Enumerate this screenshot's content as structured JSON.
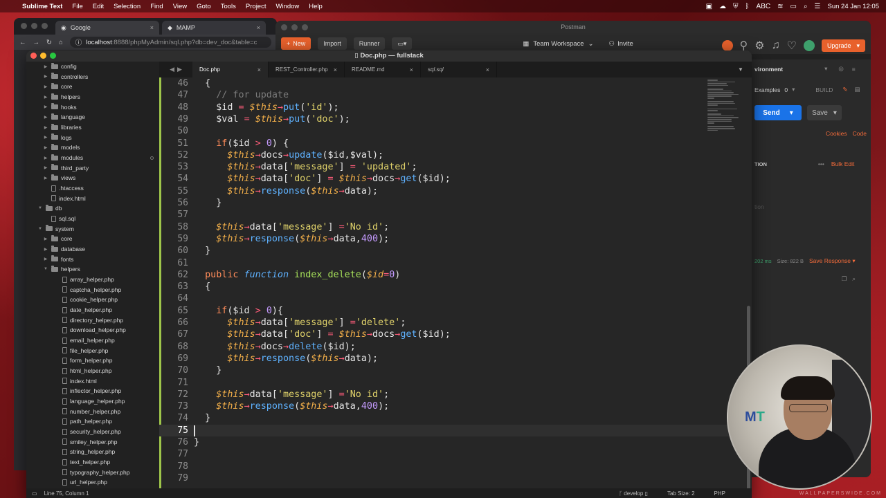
{
  "menubar": {
    "app": "Sublime Text",
    "items": [
      "File",
      "Edit",
      "Selection",
      "Find",
      "View",
      "Goto",
      "Tools",
      "Project",
      "Window",
      "Help"
    ],
    "keyboard": "ABC",
    "clock": "Sun 24 Jan  12:05"
  },
  "browser": {
    "tabs": [
      "Google",
      "MAMP"
    ],
    "url_host": "localhost",
    "url_rest": ":8888/phpMyAdmin/sql.php?db=dev_doc&table=c"
  },
  "postman": {
    "title": "Postman",
    "new": "New",
    "import": "Import",
    "runner": "Runner",
    "workspace": "Team Workspace",
    "invite": "Invite",
    "upgrade": "Upgrade",
    "environment": "vironment",
    "examples": "Examples",
    "examples_count": "0",
    "build": "BUILD",
    "send": "Send",
    "save": "Save",
    "cookies": "Cookies",
    "code": "Code",
    "description_col": "TION",
    "bulk_edit": "Bulk Edit",
    "desc_placeholder": "tion",
    "time": "202 ms",
    "size": "Size: 822 B",
    "save_response": "Save Response"
  },
  "sublime": {
    "title": "Doc.php — fullstack",
    "tabs": [
      "Doc.php",
      "REST_Controller.php",
      "README.md",
      "sql.sql"
    ],
    "sidebar": [
      {
        "label": "config",
        "type": "folder",
        "depth": 1
      },
      {
        "label": "controllers",
        "type": "folder",
        "depth": 1
      },
      {
        "label": "core",
        "type": "folder",
        "depth": 1
      },
      {
        "label": "helpers",
        "type": "folder",
        "depth": 1
      },
      {
        "label": "hooks",
        "type": "folder",
        "depth": 1
      },
      {
        "label": "language",
        "type": "folder",
        "depth": 1
      },
      {
        "label": "libraries",
        "type": "folder",
        "depth": 1
      },
      {
        "label": "logs",
        "type": "folder",
        "depth": 1
      },
      {
        "label": "models",
        "type": "folder",
        "depth": 1
      },
      {
        "label": "modules",
        "type": "folder",
        "depth": 1
      },
      {
        "label": "third_party",
        "type": "folder",
        "depth": 1
      },
      {
        "label": "views",
        "type": "folder",
        "depth": 1
      },
      {
        "label": ".htaccess",
        "type": "file",
        "depth": 1
      },
      {
        "label": "index.html",
        "type": "file",
        "depth": 1
      },
      {
        "label": "db",
        "type": "folder-open",
        "depth": 0
      },
      {
        "label": "sql.sql",
        "type": "file",
        "depth": 1
      },
      {
        "label": "system",
        "type": "folder-open",
        "depth": 0
      },
      {
        "label": "core",
        "type": "folder",
        "depth": 1
      },
      {
        "label": "database",
        "type": "folder",
        "depth": 1
      },
      {
        "label": "fonts",
        "type": "folder",
        "depth": 1
      },
      {
        "label": "helpers",
        "type": "folder-open",
        "depth": 1
      },
      {
        "label": "array_helper.php",
        "type": "file",
        "depth": 2
      },
      {
        "label": "captcha_helper.php",
        "type": "file",
        "depth": 2
      },
      {
        "label": "cookie_helper.php",
        "type": "file",
        "depth": 2
      },
      {
        "label": "date_helper.php",
        "type": "file",
        "depth": 2
      },
      {
        "label": "directory_helper.php",
        "type": "file",
        "depth": 2
      },
      {
        "label": "download_helper.php",
        "type": "file",
        "depth": 2
      },
      {
        "label": "email_helper.php",
        "type": "file",
        "depth": 2
      },
      {
        "label": "file_helper.php",
        "type": "file",
        "depth": 2
      },
      {
        "label": "form_helper.php",
        "type": "file",
        "depth": 2
      },
      {
        "label": "html_helper.php",
        "type": "file",
        "depth": 2
      },
      {
        "label": "index.html",
        "type": "file",
        "depth": 2
      },
      {
        "label": "inflector_helper.php",
        "type": "file",
        "depth": 2
      },
      {
        "label": "language_helper.php",
        "type": "file",
        "depth": 2
      },
      {
        "label": "number_helper.php",
        "type": "file",
        "depth": 2
      },
      {
        "label": "path_helper.php",
        "type": "file",
        "depth": 2
      },
      {
        "label": "security_helper.php",
        "type": "file",
        "depth": 2
      },
      {
        "label": "smiley_helper.php",
        "type": "file",
        "depth": 2
      },
      {
        "label": "string_helper.php",
        "type": "file",
        "depth": 2
      },
      {
        "label": "text_helper.php",
        "type": "file",
        "depth": 2
      },
      {
        "label": "typography_helper.php",
        "type": "file",
        "depth": 2
      },
      {
        "label": "url_helper.php",
        "type": "file",
        "depth": 2
      }
    ],
    "current_line": 75,
    "code": [
      {
        "n": 46,
        "t": [
          [
            "",
            "  {"
          ]
        ]
      },
      {
        "n": 47,
        "t": [
          [
            "cm",
            "    // for update"
          ]
        ]
      },
      {
        "n": 48,
        "t": [
          [
            "",
            "    $id "
          ],
          [
            "op",
            "="
          ],
          [
            "",
            " "
          ],
          [
            "var",
            "$this"
          ],
          [
            "op",
            "→"
          ],
          [
            "fn",
            "put"
          ],
          [
            "",
            "("
          ],
          [
            "str",
            "'id'"
          ],
          [
            "",
            ");"
          ]
        ]
      },
      {
        "n": 49,
        "t": [
          [
            "",
            "    $val "
          ],
          [
            "op",
            "="
          ],
          [
            "",
            " "
          ],
          [
            "var",
            "$this"
          ],
          [
            "op",
            "→"
          ],
          [
            "fn",
            "put"
          ],
          [
            "",
            "("
          ],
          [
            "str",
            "'doc'"
          ],
          [
            "",
            ");"
          ]
        ]
      },
      {
        "n": 50,
        "t": [
          [
            "",
            ""
          ]
        ]
      },
      {
        "n": 51,
        "t": [
          [
            "",
            "    "
          ],
          [
            "kw",
            "if"
          ],
          [
            "",
            "($id "
          ],
          [
            "op",
            ">"
          ],
          [
            "",
            " "
          ],
          [
            "num",
            "0"
          ],
          [
            "",
            ") {"
          ]
        ]
      },
      {
        "n": 52,
        "t": [
          [
            "",
            "      "
          ],
          [
            "var",
            "$this"
          ],
          [
            "op",
            "→"
          ],
          [
            "",
            "docs"
          ],
          [
            "op",
            "→"
          ],
          [
            "fn",
            "update"
          ],
          [
            "",
            "($id,$val);"
          ]
        ]
      },
      {
        "n": 53,
        "t": [
          [
            "",
            "      "
          ],
          [
            "var",
            "$this"
          ],
          [
            "op",
            "→"
          ],
          [
            "",
            "data["
          ],
          [
            "str",
            "'message'"
          ],
          [
            "",
            "] "
          ],
          [
            "op",
            "="
          ],
          [
            "",
            " "
          ],
          [
            "str",
            "'updated'"
          ],
          [
            "",
            ";"
          ]
        ]
      },
      {
        "n": 54,
        "t": [
          [
            "",
            "      "
          ],
          [
            "var",
            "$this"
          ],
          [
            "op",
            "→"
          ],
          [
            "",
            "data["
          ],
          [
            "str",
            "'doc'"
          ],
          [
            "",
            "] "
          ],
          [
            "op",
            "="
          ],
          [
            "",
            " "
          ],
          [
            "var",
            "$this"
          ],
          [
            "op",
            "→"
          ],
          [
            "",
            "docs"
          ],
          [
            "op",
            "→"
          ],
          [
            "fn",
            "get"
          ],
          [
            "",
            "($id);"
          ]
        ]
      },
      {
        "n": 55,
        "t": [
          [
            "",
            "      "
          ],
          [
            "var",
            "$this"
          ],
          [
            "op",
            "→"
          ],
          [
            "fn",
            "response"
          ],
          [
            "",
            "("
          ],
          [
            "var",
            "$this"
          ],
          [
            "op",
            "→"
          ],
          [
            "",
            "data);"
          ]
        ]
      },
      {
        "n": 56,
        "t": [
          [
            "",
            "    }"
          ]
        ]
      },
      {
        "n": 57,
        "t": [
          [
            "",
            ""
          ]
        ]
      },
      {
        "n": 58,
        "t": [
          [
            "",
            "    "
          ],
          [
            "var",
            "$this"
          ],
          [
            "op",
            "→"
          ],
          [
            "",
            "data["
          ],
          [
            "str",
            "'message'"
          ],
          [
            "",
            "] "
          ],
          [
            "op",
            "="
          ],
          [
            "str",
            "'No id'"
          ],
          [
            "",
            ";"
          ]
        ]
      },
      {
        "n": 59,
        "t": [
          [
            "",
            "    "
          ],
          [
            "var",
            "$this"
          ],
          [
            "op",
            "→"
          ],
          [
            "fn",
            "response"
          ],
          [
            "",
            "("
          ],
          [
            "var",
            "$this"
          ],
          [
            "op",
            "→"
          ],
          [
            "",
            "data,"
          ],
          [
            "num",
            "400"
          ],
          [
            "",
            ");"
          ]
        ]
      },
      {
        "n": 60,
        "t": [
          [
            "",
            "  }"
          ]
        ]
      },
      {
        "n": 61,
        "t": [
          [
            "",
            ""
          ]
        ]
      },
      {
        "n": 62,
        "t": [
          [
            "",
            "  "
          ],
          [
            "kw",
            "public"
          ],
          [
            "",
            " "
          ],
          [
            "kwf",
            "function"
          ],
          [
            "",
            " "
          ],
          [
            "def",
            "index_delete"
          ],
          [
            "",
            "("
          ],
          [
            "var",
            "$id"
          ],
          [
            "op",
            "="
          ],
          [
            "num",
            "0"
          ],
          [
            "",
            ")"
          ]
        ]
      },
      {
        "n": 63,
        "t": [
          [
            "",
            "  {"
          ]
        ]
      },
      {
        "n": 64,
        "t": [
          [
            "",
            ""
          ]
        ]
      },
      {
        "n": 65,
        "t": [
          [
            "",
            "    "
          ],
          [
            "kw",
            "if"
          ],
          [
            "",
            "($id "
          ],
          [
            "op",
            ">"
          ],
          [
            "",
            " "
          ],
          [
            "num",
            "0"
          ],
          [
            "",
            "){"
          ]
        ]
      },
      {
        "n": 66,
        "t": [
          [
            "",
            "      "
          ],
          [
            "var",
            "$this"
          ],
          [
            "op",
            "→"
          ],
          [
            "",
            "data["
          ],
          [
            "str",
            "'message'"
          ],
          [
            "",
            "] "
          ],
          [
            "op",
            "="
          ],
          [
            "str",
            "'delete'"
          ],
          [
            "",
            ";"
          ]
        ]
      },
      {
        "n": 67,
        "t": [
          [
            "",
            "      "
          ],
          [
            "var",
            "$this"
          ],
          [
            "op",
            "→"
          ],
          [
            "",
            "data["
          ],
          [
            "str",
            "'doc'"
          ],
          [
            "",
            "] "
          ],
          [
            "op",
            "="
          ],
          [
            "",
            " "
          ],
          [
            "var",
            "$this"
          ],
          [
            "op",
            "→"
          ],
          [
            "",
            "docs"
          ],
          [
            "op",
            "→"
          ],
          [
            "fn",
            "get"
          ],
          [
            "",
            "($id);"
          ]
        ]
      },
      {
        "n": 68,
        "t": [
          [
            "",
            "      "
          ],
          [
            "var",
            "$this"
          ],
          [
            "op",
            "→"
          ],
          [
            "",
            "docs"
          ],
          [
            "op",
            "→"
          ],
          [
            "fn",
            "delete"
          ],
          [
            "",
            "($id);"
          ]
        ]
      },
      {
        "n": 69,
        "t": [
          [
            "",
            "      "
          ],
          [
            "var",
            "$this"
          ],
          [
            "op",
            "→"
          ],
          [
            "fn",
            "response"
          ],
          [
            "",
            "("
          ],
          [
            "var",
            "$this"
          ],
          [
            "op",
            "→"
          ],
          [
            "",
            "data);"
          ]
        ]
      },
      {
        "n": 70,
        "t": [
          [
            "",
            "    }"
          ]
        ]
      },
      {
        "n": 71,
        "t": [
          [
            "",
            ""
          ]
        ]
      },
      {
        "n": 72,
        "t": [
          [
            "",
            "    "
          ],
          [
            "var",
            "$this"
          ],
          [
            "op",
            "→"
          ],
          [
            "",
            "data["
          ],
          [
            "str",
            "'message'"
          ],
          [
            "",
            "] "
          ],
          [
            "op",
            "="
          ],
          [
            "str",
            "'No id'"
          ],
          [
            "",
            ";"
          ]
        ]
      },
      {
        "n": 73,
        "t": [
          [
            "",
            "    "
          ],
          [
            "var",
            "$this"
          ],
          [
            "op",
            "→"
          ],
          [
            "fn",
            "response"
          ],
          [
            "",
            "("
          ],
          [
            "var",
            "$this"
          ],
          [
            "op",
            "→"
          ],
          [
            "",
            "data,"
          ],
          [
            "num",
            "400"
          ],
          [
            "",
            ");"
          ]
        ]
      },
      {
        "n": 74,
        "t": [
          [
            "",
            "  }"
          ]
        ]
      },
      {
        "n": 75,
        "t": [
          [
            "",
            ""
          ]
        ]
      },
      {
        "n": 76,
        "t": [
          [
            "",
            "}"
          ]
        ]
      },
      {
        "n": 77,
        "t": [
          [
            "",
            ""
          ]
        ]
      },
      {
        "n": 78,
        "t": [
          [
            "",
            ""
          ]
        ]
      },
      {
        "n": 79,
        "t": [
          [
            "",
            ""
          ]
        ]
      }
    ],
    "status": {
      "position": "Line 75, Column 1",
      "branch": "develop",
      "tab_size": "Tab Size: 2",
      "syntax": "PHP"
    }
  },
  "webcam": {
    "logo_a": "M",
    "logo_b": "T",
    "watermark": "WALLPAPERSWIDE.COM"
  }
}
